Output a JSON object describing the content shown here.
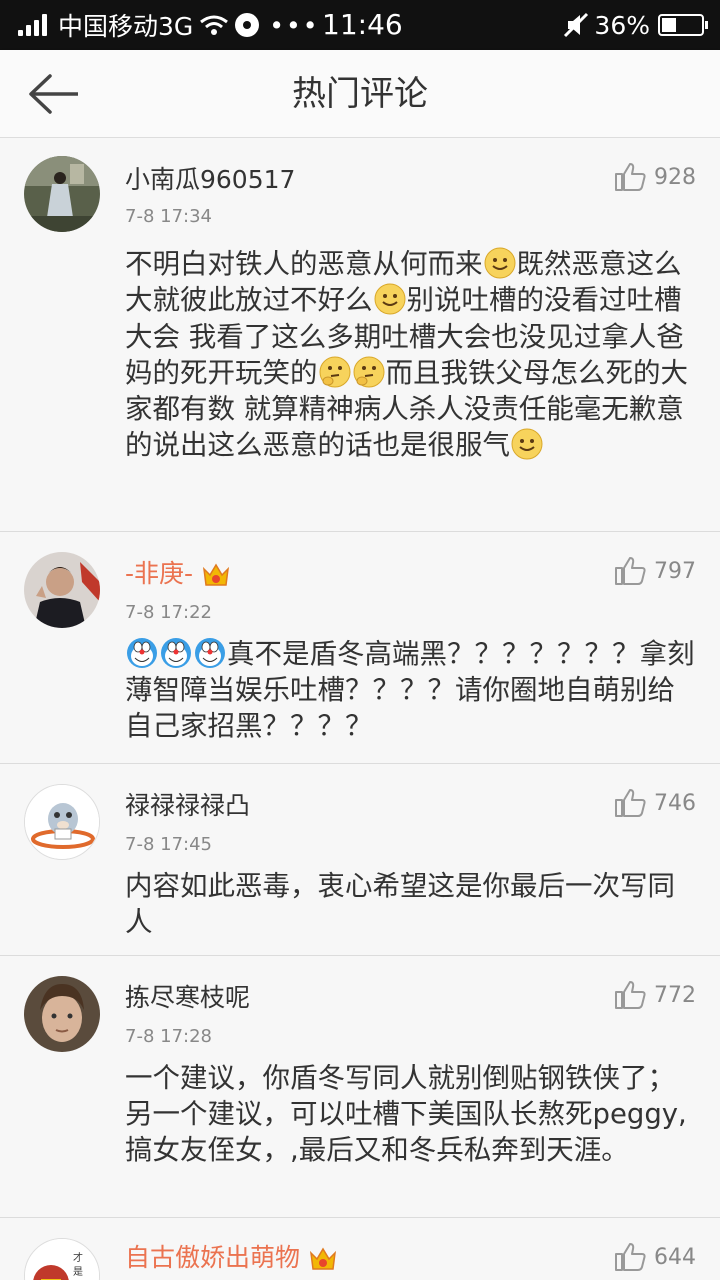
{
  "status_bar": {
    "carrier": "中国移动3G",
    "time": "11:46",
    "battery": "36%",
    "battery_level": 0.36
  },
  "nav": {
    "title": "热门评论"
  },
  "colors": {
    "vip_name": "#eb7350",
    "text": "#333333",
    "meta": "#888888"
  },
  "comments": [
    {
      "name": "小南瓜960517",
      "time": "7-8 17:34",
      "likes": "928",
      "text": [
        "不明白对铁人的恶意从何而来",
        "既然恶意这么大就彼此放过不好么",
        "别说吐槽的没看过吐槽大会 我看了这么多期吐槽大会也没见过拿人爸妈的死开玩笑的",
        "而且我铁父母怎么死的大家都有数 就算精神病人杀人没责任能毫无歉意的说出这么恶意的话也是很服气"
      ]
    },
    {
      "name": "-非庚-",
      "time": "7-8 17:22",
      "likes": "797",
      "text": [
        "真不是盾冬高端黑？？？？？？？拿刻薄智障当娱乐吐槽？？？？请你圈地自萌别给自己家招黑？？？？"
      ]
    },
    {
      "name": "禄禄禄禄凸",
      "time": "7-8 17:45",
      "likes": "746",
      "text": [
        "内容如此恶毒，衷心希望这是你最后一次写同人"
      ]
    },
    {
      "name": "拣尽寒枝呢",
      "time": "7-8 17:28",
      "likes": "772",
      "text": [
        "一个建议，你盾冬写同人就别倒贴钢铁侠了；另一个建议，可以吐槽下美国队长熬死peggy,搞女友侄女，,最后又和冬兵私奔到天涯。"
      ]
    },
    {
      "name": "自古傲娇出萌物",
      "likes": "644"
    }
  ]
}
